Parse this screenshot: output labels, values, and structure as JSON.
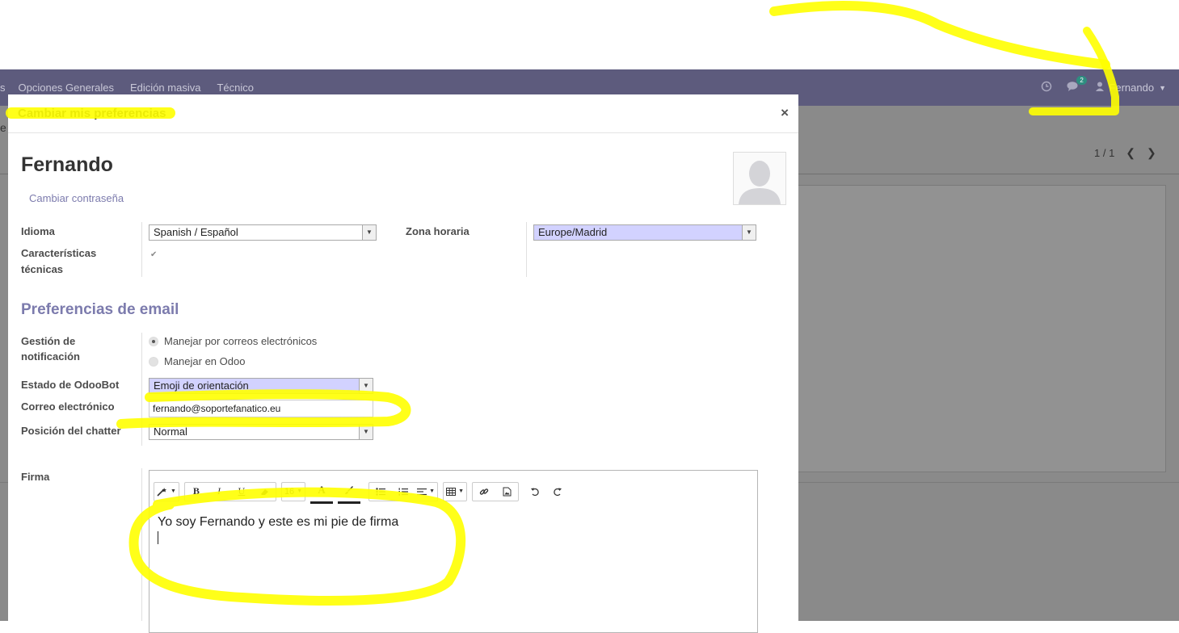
{
  "navbar": {
    "menu": [
      {
        "label": "s"
      },
      {
        "label": "Opciones Generales"
      },
      {
        "label": "Edición masiva"
      },
      {
        "label": "Técnico"
      }
    ],
    "chat_badge": "2",
    "user_name": "Fernando"
  },
  "background": {
    "left_fragment": "e",
    "pager": "1 / 1"
  },
  "modal": {
    "title": "Cambiar mis preferencias",
    "close_label": "×",
    "user_name": "Fernando",
    "change_password": "Cambiar contraseña",
    "fields": {
      "language_label": "Idioma",
      "language_value": "Spanish / Español",
      "timezone_label": "Zona horaria",
      "timezone_value": "Europe/Madrid",
      "tech_features_label_1": "Características",
      "tech_features_label_2": "técnicas"
    },
    "email_section": {
      "title": "Preferencias de email",
      "notification_label_1": "Gestión de",
      "notification_label_2": "notificación",
      "options": [
        {
          "label": "Manejar por correos electrónicos",
          "selected": true
        },
        {
          "label": "Manejar en Odoo",
          "selected": false
        }
      ],
      "odoobot_label": "Estado de OdooBot",
      "odoobot_value": "Emoji de orientación",
      "email_label": "Correo electrónico",
      "email_value": "fernando@soportefanatico.eu",
      "chatter_label": "Posición del chatter",
      "chatter_value": "Normal"
    },
    "signature": {
      "label": "Firma",
      "font_size": "16",
      "text": "Yo soy Fernando y este es mi pie de firma"
    }
  },
  "colors": {
    "navbar": "#5d5b7d",
    "accent": "#7c7bad",
    "highlighter": "#ffff00",
    "select_highlight": "#d2d2ff"
  }
}
